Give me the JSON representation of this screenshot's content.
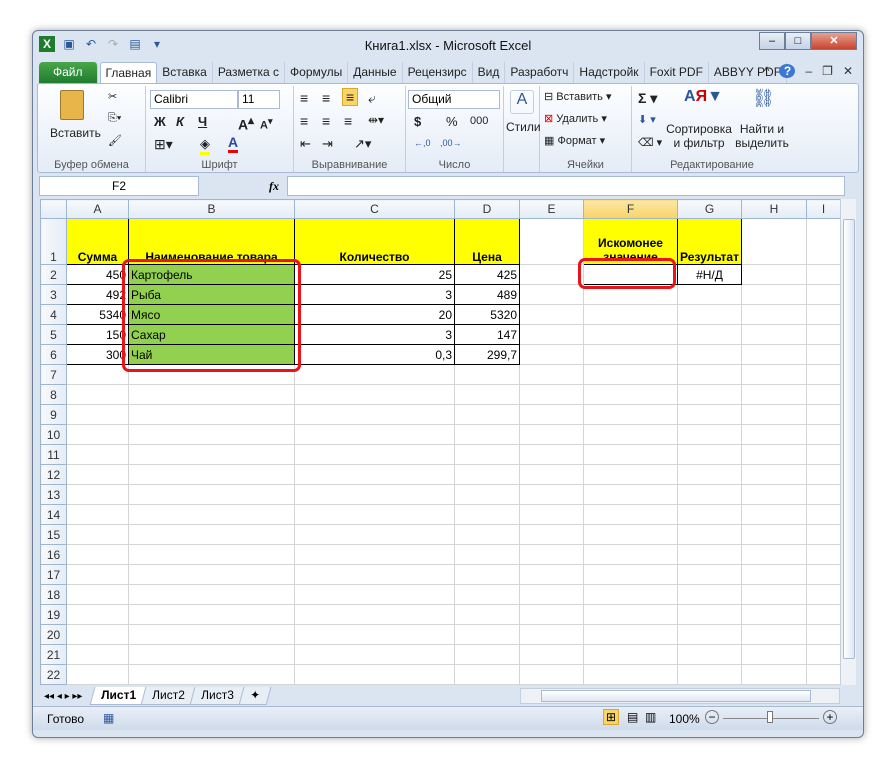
{
  "window": {
    "title": "Книга1.xlsx - Microsoft Excel",
    "min": "–",
    "max": "□",
    "close": "✕"
  },
  "ribbon_tabs": [
    "Файл",
    "Главная",
    "Вставка",
    "Разметка с",
    "Формулы",
    "Данные",
    "Рецензирс",
    "Вид",
    "Разработч",
    "Надстройк",
    "Foxit PDF",
    "ABBYY PDF"
  ],
  "clipboard": {
    "paste": "Вставить",
    "label": "Буфер обмена"
  },
  "font": {
    "name": "Calibri",
    "size": "11",
    "bold": "Ж",
    "italic": "К",
    "underline": "Ч",
    "label": "Шрифт"
  },
  "alignment": {
    "label": "Выравнивание"
  },
  "number": {
    "format": "Общий",
    "currency": "$",
    "percent": "%",
    "thousands": "000",
    "label": "Число"
  },
  "styles": {
    "label": "Стили"
  },
  "cells": {
    "insert": "Вставить",
    "delete": "Удалить",
    "format": "Формат",
    "label": "Ячейки"
  },
  "editing": {
    "sort": "Сортировка и фильтр",
    "find": "Найти и выделить",
    "label": "Редактирование"
  },
  "formula_bar": {
    "name_box": "F2",
    "fx": "fx",
    "value": ""
  },
  "columns": [
    "A",
    "B",
    "C",
    "D",
    "E",
    "F",
    "G",
    "H",
    "I"
  ],
  "selected_column": "F",
  "rows": [
    [
      "Сумма",
      "Наименование товара",
      "Количество",
      "Цена",
      "",
      "Искомонее значение",
      "Результат",
      "",
      ""
    ],
    [
      "450",
      "Картофель",
      "25",
      "425",
      "",
      "",
      "#Н/Д",
      "",
      ""
    ],
    [
      "492",
      "Рыба",
      "3",
      "489",
      "",
      "",
      "",
      "",
      ""
    ],
    [
      "5340",
      "Мясо",
      "20",
      "5320",
      "",
      "",
      "",
      "",
      ""
    ],
    [
      "150",
      "Сахар",
      "3",
      "147",
      "",
      "",
      "",
      "",
      ""
    ],
    [
      "300",
      "Чай",
      "0,3",
      "299,7",
      "",
      "",
      "",
      "",
      ""
    ]
  ],
  "total_rows": 22,
  "sheets": [
    "Лист1",
    "Лист2",
    "Лист3"
  ],
  "active_sheet": "Лист1",
  "status": {
    "ready": "Готово",
    "zoom": "100%"
  }
}
